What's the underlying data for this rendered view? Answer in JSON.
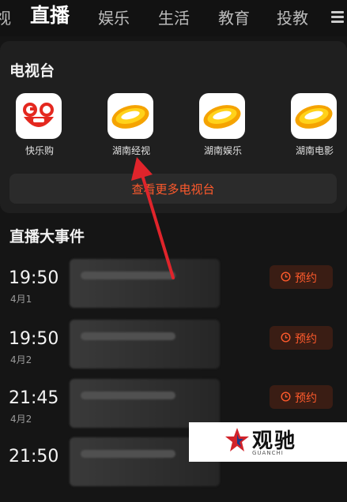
{
  "top_nav": {
    "tabs": [
      "视",
      "直播",
      "娱乐",
      "生活",
      "教育",
      "投教"
    ],
    "active_index": 1,
    "menu_icon": "menu-icon"
  },
  "tv_section": {
    "title": "电视台",
    "channels": [
      {
        "name": "快乐购",
        "logo": "happigo-logo"
      },
      {
        "name": "湖南经视",
        "logo": "mango-logo"
      },
      {
        "name": "湖南娱乐",
        "logo": "mango-logo"
      },
      {
        "name": "湖南电影",
        "logo": "mango-logo"
      }
    ],
    "more_label": "查看更多电视台"
  },
  "events_section": {
    "title": "直播大事件",
    "events": [
      {
        "time": "19:50",
        "date": "4月1",
        "action": "预约"
      },
      {
        "time": "19:50",
        "date": "4月2",
        "action": "预约"
      },
      {
        "time": "21:45",
        "date": "4月2",
        "action": "预约"
      },
      {
        "time": "21:50",
        "date": "",
        "action": ""
      }
    ]
  },
  "watermark": {
    "text": "观驰",
    "subtext": "GUANCHI"
  },
  "colors": {
    "accent": "#ff5a2c",
    "background": "#151515",
    "card": "#1f1f1f",
    "annotation_arrow": "#e0242b"
  }
}
